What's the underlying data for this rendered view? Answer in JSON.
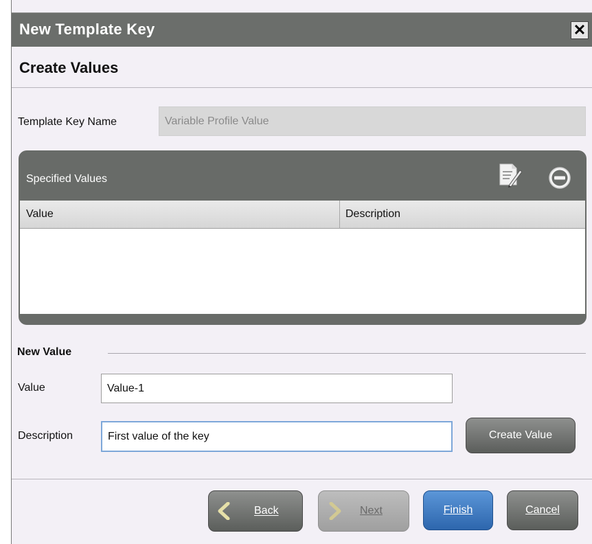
{
  "dialog": {
    "title": "New Template Key",
    "close_label": "✕",
    "section_title": "Create Values"
  },
  "template_key": {
    "label": "Template Key Name",
    "value": "Variable Profile Value"
  },
  "specified_values": {
    "title": "Specified Values",
    "columns": [
      "Value",
      "Description"
    ],
    "rows": [],
    "icons": [
      "edit-value-icon",
      "remove-value-icon"
    ]
  },
  "new_value": {
    "legend": "New Value",
    "value_label": "Value",
    "value": "Value-1",
    "description_label": "Description",
    "description": "First value of the key",
    "create_label": "Create Value"
  },
  "footer": {
    "back_label": "Back",
    "next_label": "Next",
    "finish_label": "Finish",
    "cancel_label": "Cancel"
  },
  "colors": {
    "titlebar": "#6b6e6b",
    "panel": "#686b68",
    "primary": "#2d66ad",
    "dialog_bg": "#f3f0f6"
  }
}
